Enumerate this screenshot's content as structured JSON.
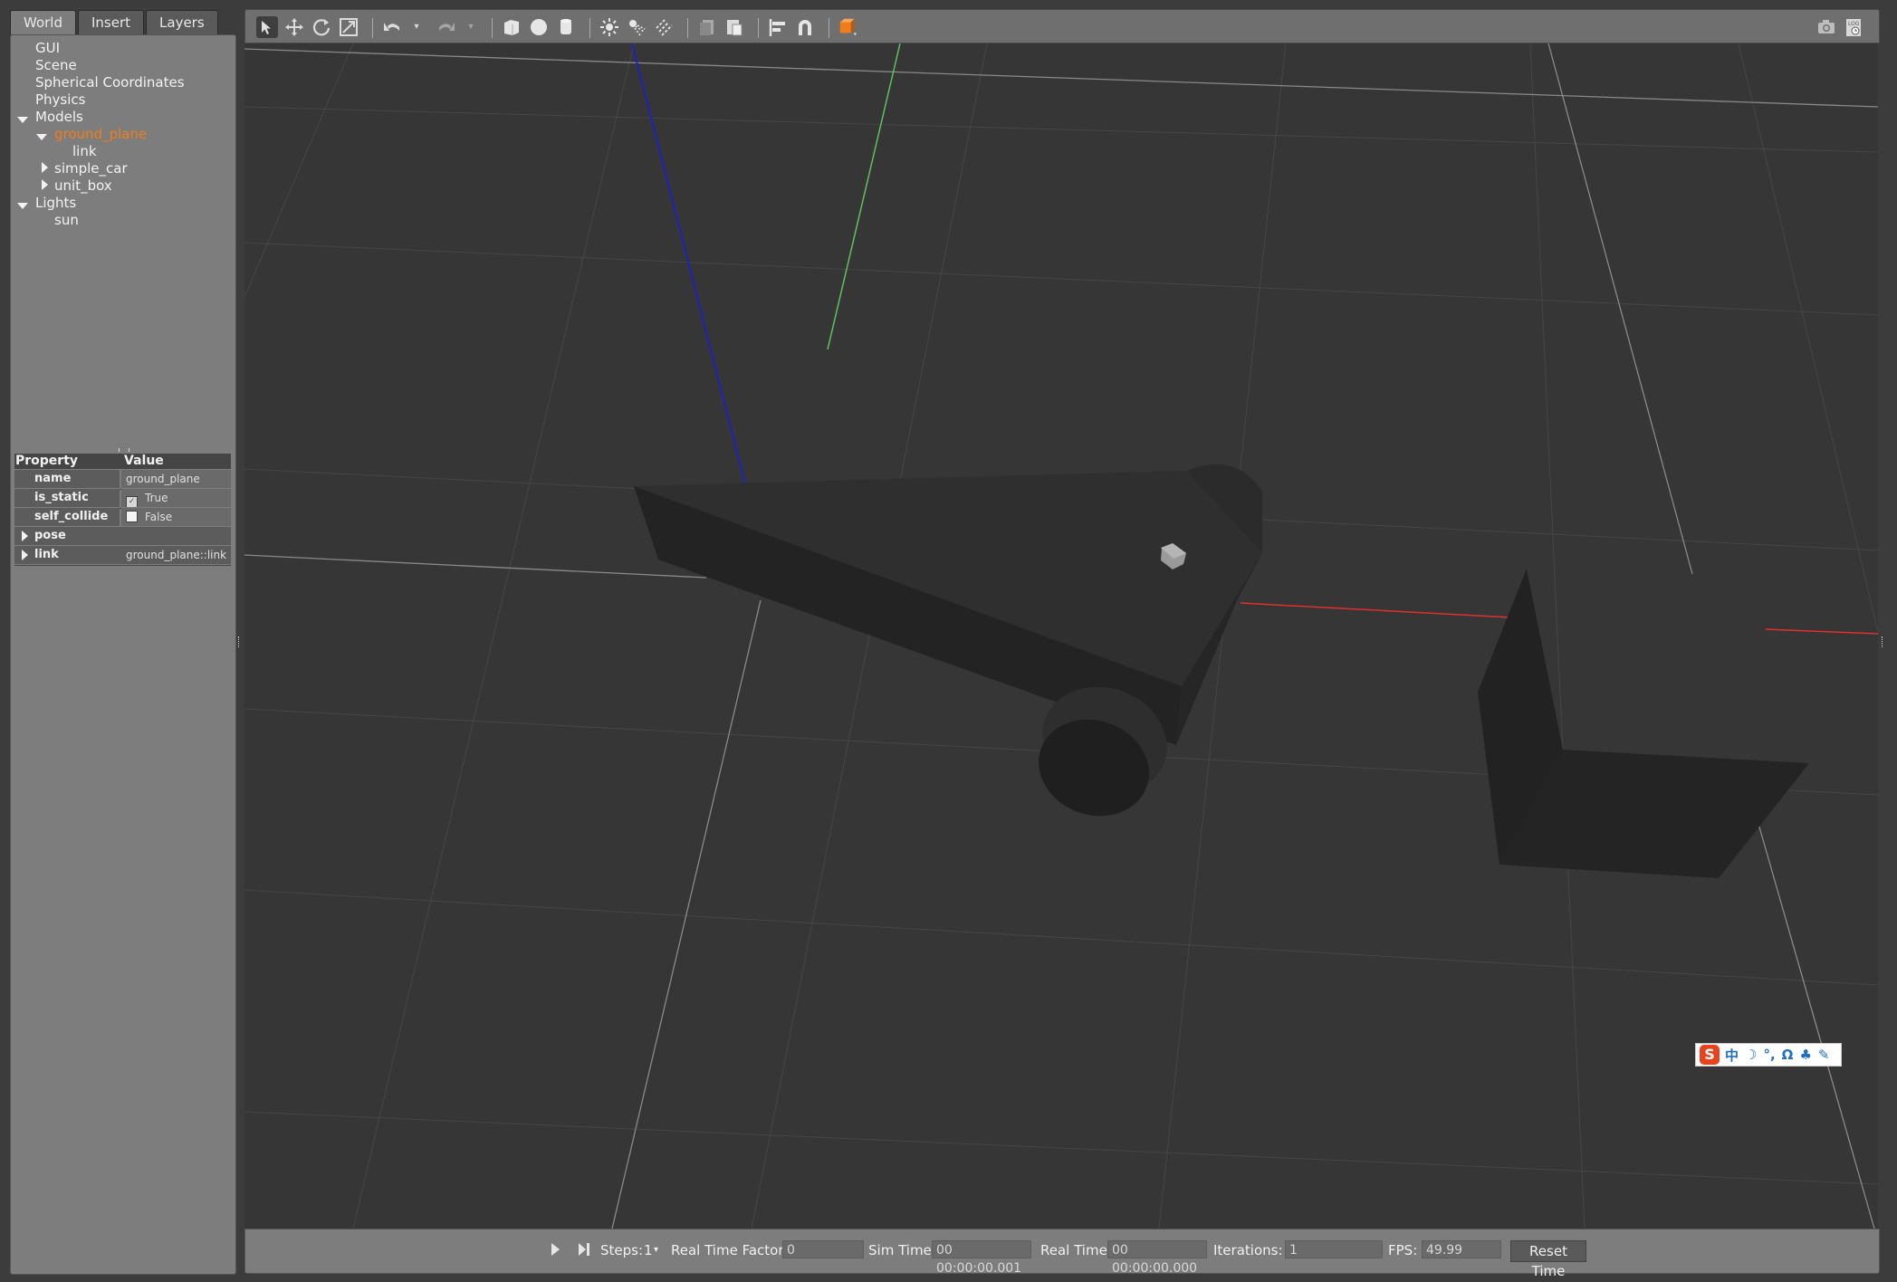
{
  "tabs": [
    {
      "label": "World"
    },
    {
      "label": "Insert"
    },
    {
      "label": "Layers"
    }
  ],
  "tree": {
    "gui": "GUI",
    "scene": "Scene",
    "spherical": "Spherical Coordinates",
    "physics": "Physics",
    "models": "Models",
    "ground_plane": "ground_plane",
    "link": "link",
    "simple_car": "simple_car",
    "unit_box": "unit_box",
    "lights": "Lights",
    "sun": "sun"
  },
  "properties": {
    "header_property": "Property",
    "header_value": "Value",
    "name_key": "name",
    "name_value": "ground_plane",
    "is_static_key": "is_static",
    "is_static_value": "True",
    "self_collide_key": "self_collide",
    "self_collide_value": "False",
    "pose_key": "pose",
    "link_key": "link",
    "link_value": "ground_plane::link"
  },
  "toolbar": {
    "icons": [
      "select-arrow-icon",
      "translate-icon",
      "rotate-icon",
      "scale-icon",
      "undo-icon",
      "redo-icon",
      "box-icon",
      "sphere-icon",
      "cylinder-icon",
      "point-light-icon",
      "spot-light-icon",
      "directional-light-icon",
      "copy-icon",
      "paste-icon",
      "align-icon",
      "snap-magnet-icon",
      "view-angle-icon",
      "screenshot-camera-icon",
      "log-icon"
    ]
  },
  "bottom": {
    "steps_label": "Steps:",
    "steps_value": "1",
    "rtf_label": "Real Time Factor:",
    "rtf_value": "0",
    "sim_time_label": "Sim Time:",
    "sim_time_value": "00 00:00:00.001",
    "real_time_label": "Real Time:",
    "real_time_value": "00 00:00:00.000",
    "iterations_label": "Iterations:",
    "iterations_value": "1",
    "fps_label": "FPS:",
    "fps_value": "49.99",
    "reset_label": "Reset Time"
  },
  "ime": {
    "logo": "S",
    "chars": [
      "中",
      "☽",
      "°,",
      "Ω",
      "♣",
      "✎"
    ]
  },
  "colors": {
    "selected_item": "#f07d1a",
    "axis_x": "#e03030",
    "axis_y": "#60c060",
    "axis_z": "#2020c0"
  }
}
